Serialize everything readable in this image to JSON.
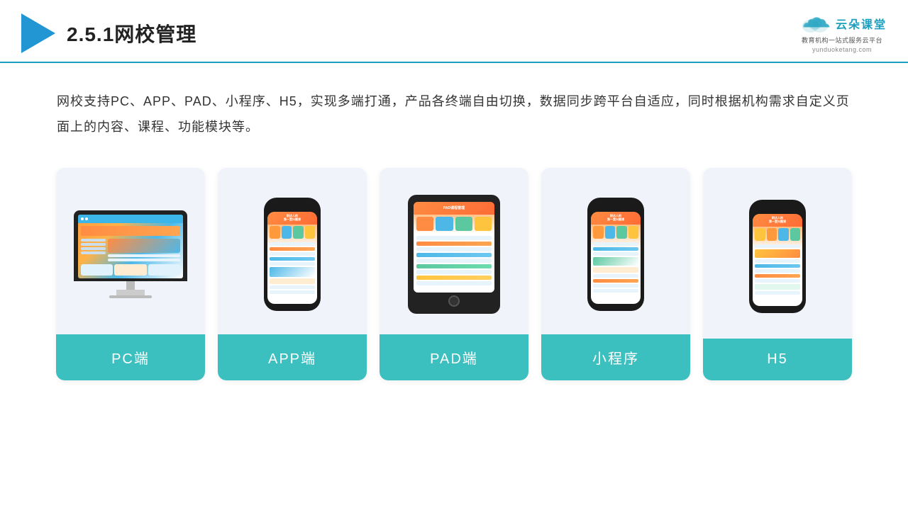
{
  "header": {
    "title": "2.5.1网校管理",
    "brand_name": "云朵课堂",
    "brand_url": "yunduoketang.com",
    "brand_tagline": "教育机构一站",
    "brand_tagline2": "式服务云平台"
  },
  "description": {
    "text": "网校支持PC、APP、PAD、小程序、H5，实现多端打通，产品各终端自由切换，数据同步跨平台自适应，同时根据机构需求自定义页面上的内容、课程、功能模块等。"
  },
  "cards": [
    {
      "label": "PC端",
      "type": "pc"
    },
    {
      "label": "APP端",
      "type": "phone"
    },
    {
      "label": "PAD端",
      "type": "pad"
    },
    {
      "label": "小程序",
      "type": "phone"
    },
    {
      "label": "H5",
      "type": "phone"
    }
  ]
}
